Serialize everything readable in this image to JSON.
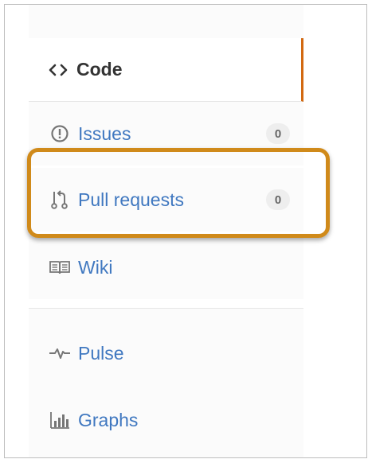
{
  "nav": {
    "items": [
      {
        "label": "Code",
        "icon": "code-icon",
        "selected": true
      },
      {
        "label": "Issues",
        "icon": "issue-opened-icon",
        "count": "0"
      },
      {
        "label": "Pull requests",
        "icon": "git-pull-request-icon",
        "count": "0"
      },
      {
        "label": "Wiki",
        "icon": "book-icon"
      },
      {
        "label": "Pulse",
        "icon": "pulse-icon"
      },
      {
        "label": "Graphs",
        "icon": "graph-icon"
      }
    ]
  },
  "colors": {
    "link": "#4078c0",
    "selected_text": "#333333",
    "selected_accent": "#d26911",
    "highlight_border": "#d08a1a",
    "counter_bg": "#eeeeee"
  }
}
